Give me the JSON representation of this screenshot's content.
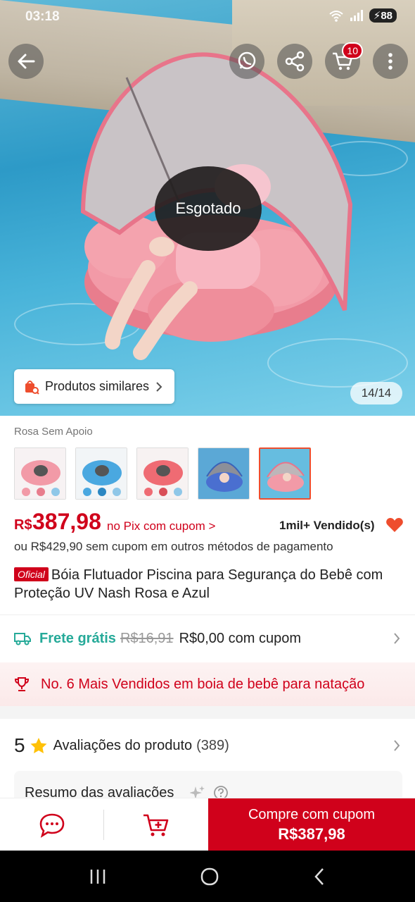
{
  "status": {
    "time": "03:18",
    "battery": "88"
  },
  "hero": {
    "sold_out": "Esgotado",
    "similar_label": "Produtos similares",
    "image_counter": "14/14"
  },
  "header": {
    "cart_badge": "10"
  },
  "variants": {
    "title": "Rosa Sem Apoio",
    "options": [
      "pink-float",
      "blue-float",
      "red-float",
      "blue-canopy-float",
      "pink-canopy-float"
    ],
    "selected": 4
  },
  "price": {
    "currency": "R$",
    "value": "387,98",
    "pix_label": "no Pix com cupom >",
    "sold": "1mil+ Vendido(s)",
    "alt": "ou R$429,90 sem cupom em outros métodos de pagamento"
  },
  "product": {
    "badge": "Oficial",
    "title": "Bóia Flutuador Piscina para Segurança do Bebê com Proteção UV Nash Rosa e Azul"
  },
  "shipping": {
    "free_label": "Frete grátis",
    "old_price": "R$16,91",
    "new_price": "R$0,00 com cupom"
  },
  "ranking": {
    "text": "No. 6 Mais Vendidos em boia de bebê para natação"
  },
  "reviews": {
    "rating": "5",
    "label": "Avaliações do produto",
    "count": "(389)",
    "summary_title": "Resumo das avaliações"
  },
  "bottom": {
    "buy_label": "Compre com cupom",
    "buy_price": "R$387,98"
  },
  "colors": {
    "accent": "#d0011b",
    "shipping": "#26aa99"
  }
}
